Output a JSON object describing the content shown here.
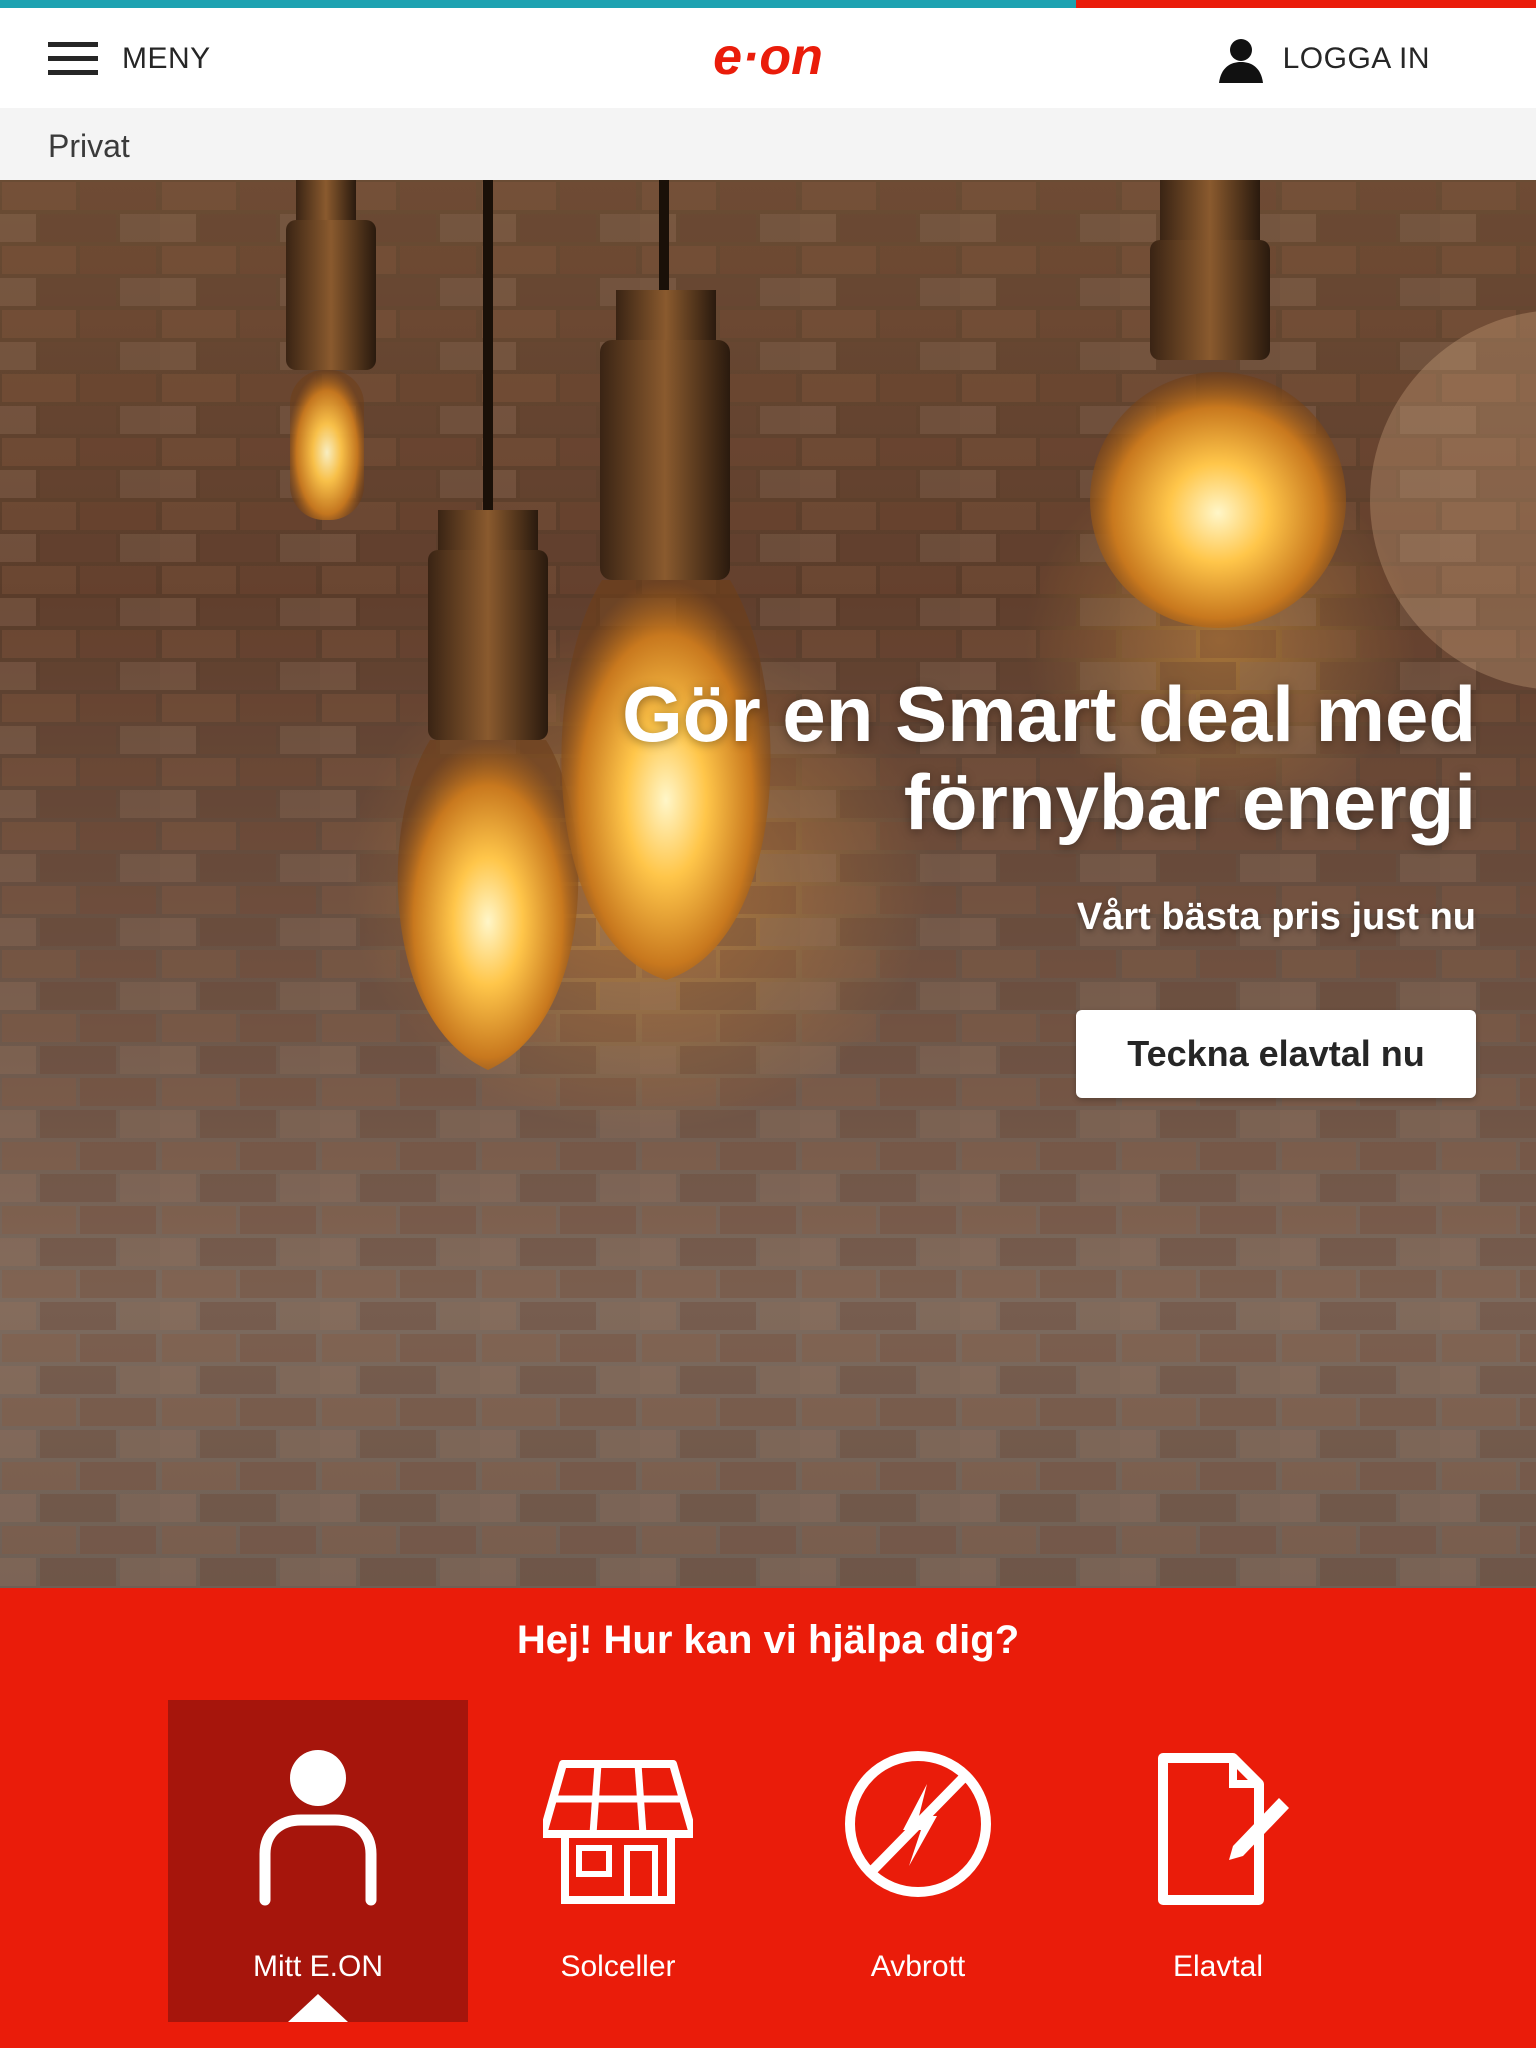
{
  "header": {
    "menu_label": "MENY",
    "logo_text": "e·on",
    "login_label": "LOGGA IN",
    "brand_color": "#ea1c0a",
    "accent_color": "#1ea2b1"
  },
  "breadcrumb": {
    "label": "Privat"
  },
  "hero": {
    "title": "Gör en Smart deal med förnybar energi",
    "subtitle": "Vårt bästa pris just nu",
    "cta_label": "Teckna elavtal nu"
  },
  "help": {
    "title": "Hej! Hur kan vi hjälpa dig?",
    "tiles": [
      {
        "label": "Mitt E.ON",
        "icon": "person-icon",
        "active": true
      },
      {
        "label": "Solceller",
        "icon": "solar-house-icon",
        "active": false
      },
      {
        "label": "Avbrott",
        "icon": "power-outage-icon",
        "active": false
      },
      {
        "label": "Elavtal",
        "icon": "contract-icon",
        "active": false
      }
    ]
  }
}
